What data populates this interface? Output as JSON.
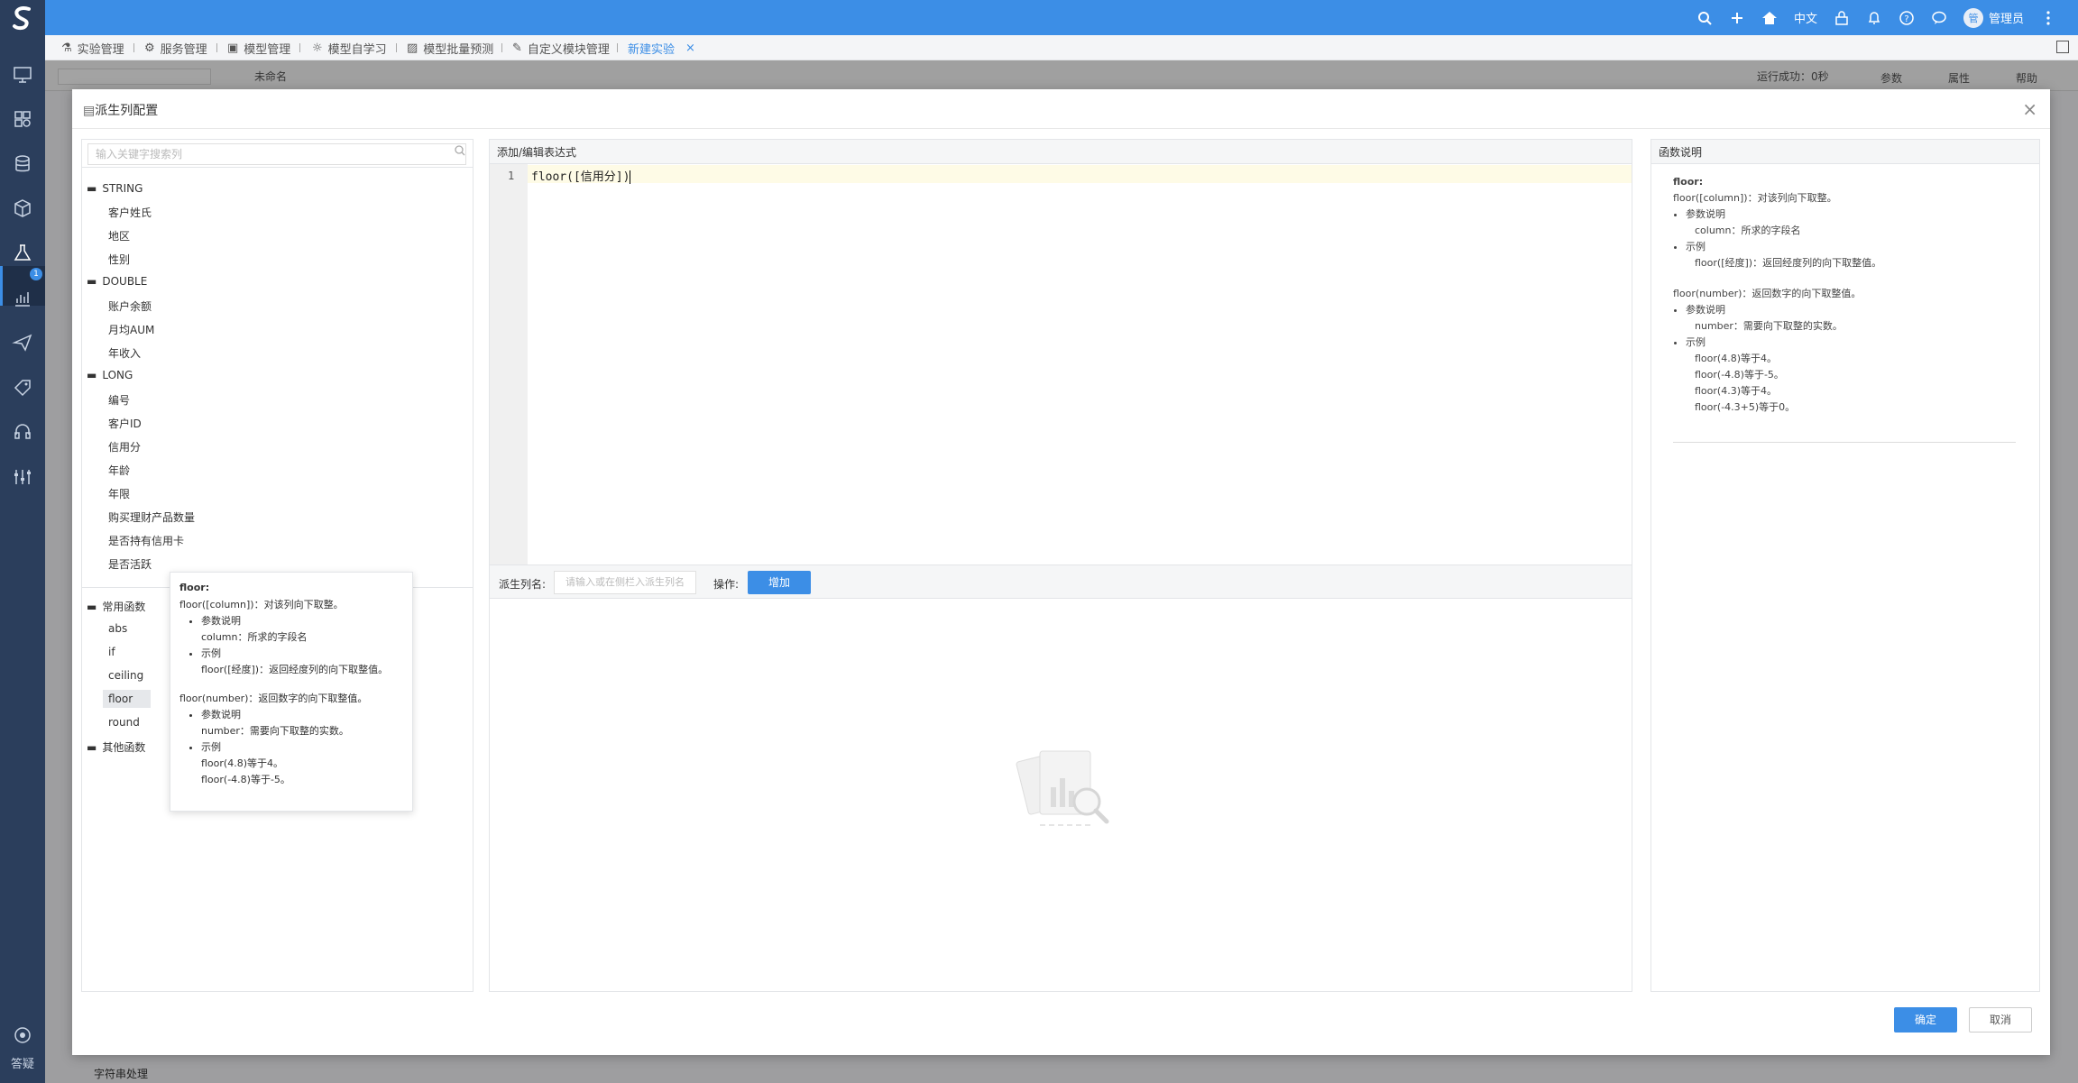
{
  "topbar": {
    "language": "中文",
    "user_initial": "管",
    "user_name": "管理员"
  },
  "tabs": [
    {
      "label": "实验管理"
    },
    {
      "label": "服务管理"
    },
    {
      "label": "模型管理"
    },
    {
      "label": "模型自学习"
    },
    {
      "label": "模型批量预测"
    },
    {
      "label": "自定义模块管理"
    },
    {
      "label": "新建实验"
    }
  ],
  "background": {
    "experiment_name": "未命名",
    "run_status": "运行成功：0秒",
    "tab_params": "参数",
    "tab_attr": "属性",
    "tab_help": "帮助",
    "node_label": "字符串处理"
  },
  "sidebar": {
    "help_label": "答疑",
    "badge": "1"
  },
  "modal": {
    "title": "派生列配置",
    "search_placeholder": "输入关键字搜索列",
    "groups": [
      {
        "name": "STRING",
        "items": [
          "客户姓氏",
          "地区",
          "性别"
        ]
      },
      {
        "name": "DOUBLE",
        "items": [
          "账户余额",
          "月均AUM",
          "年收入"
        ]
      },
      {
        "name": "LONG",
        "items": [
          "编号",
          "客户ID",
          "信用分",
          "年龄",
          "年限",
          "购买理财产品数量",
          "是否持有信用卡",
          "是否活跃"
        ]
      }
    ],
    "func_groups": [
      {
        "name": "常用函数",
        "items": [
          "abs",
          "if",
          "ceiling",
          "floor",
          "round"
        ]
      },
      {
        "name": "其他函数",
        "items": []
      }
    ],
    "editor_title": "添加/编辑表达式",
    "line_number": "1",
    "expression": "floor([信用分])",
    "alias_label": "派生列名:",
    "alias_placeholder": "请输入或在侧栏入派生列名",
    "op_label": "操作:",
    "add_button": "增加",
    "doc_title": "函数说明",
    "ok_button": "确定",
    "cancel_button": "取消"
  },
  "doc": {
    "name": "floor:",
    "sig1": "floor([column])：对该列向下取整。",
    "params_label": "参数说明",
    "param1": "column：所求的字段名",
    "example_label": "示例",
    "example1": "floor([经度])：返回经度列的向下取整值。",
    "sig2": "floor(number)：返回数字的向下取整值。",
    "param2": "number：需要向下取整的实数。",
    "ex2_1": "floor(4.8)等于4。",
    "ex2_2": "floor(-4.8)等于-5。",
    "ex2_3": "floor(4.3)等于4。",
    "ex2_4": "floor(-4.3+5)等于0。"
  },
  "colors": {
    "primary": "#3c8ee6",
    "sidebar": "#2b3e5c"
  }
}
